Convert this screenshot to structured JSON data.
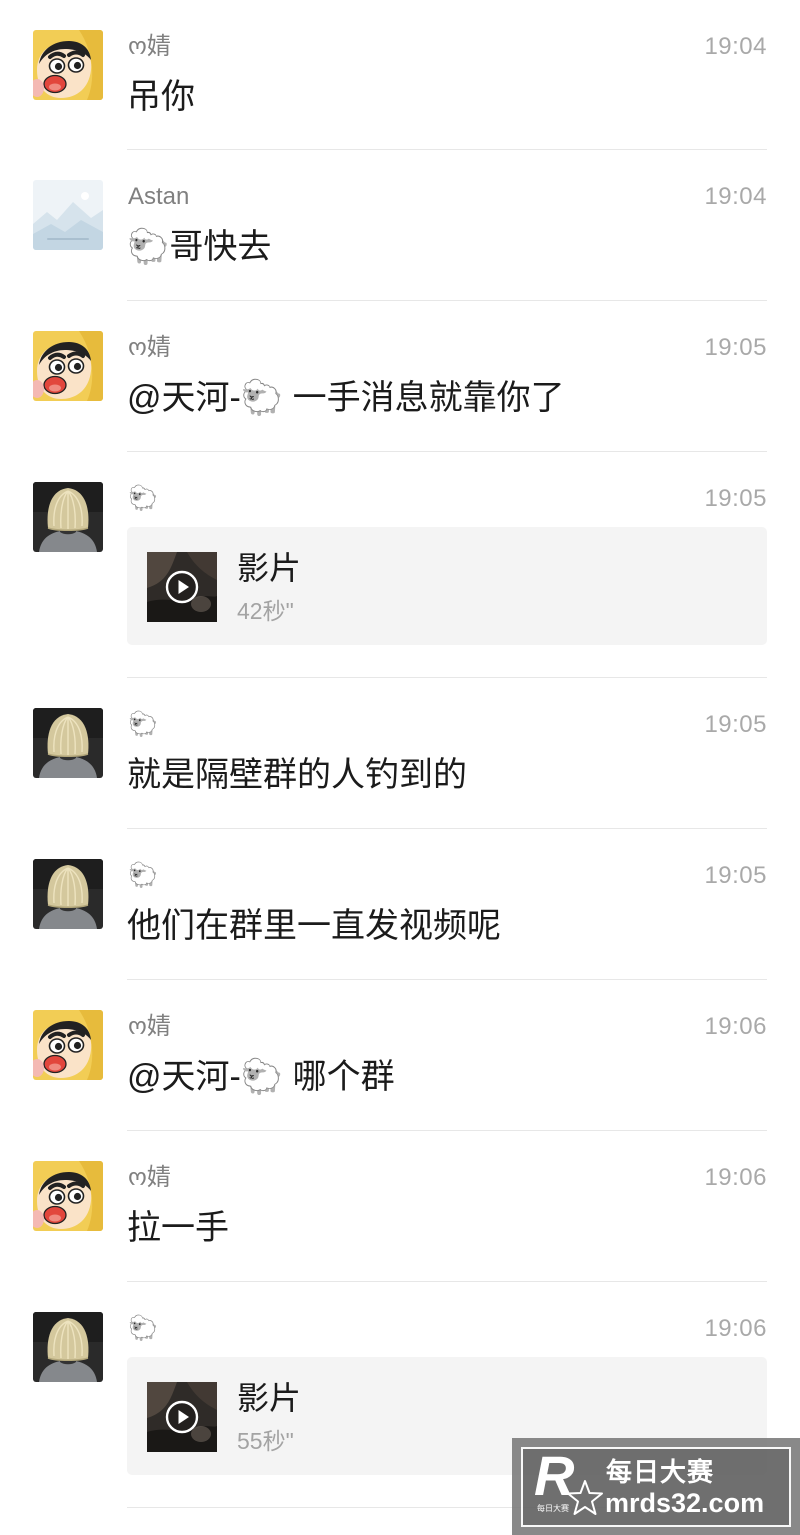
{
  "messages": [
    {
      "sender": "ო婧",
      "avatar": "shinchan-avatar",
      "time": "19:04",
      "text": "吊你"
    },
    {
      "sender": "Astan",
      "avatar": "landscape-avatar",
      "time": "19:04",
      "text": "🐑哥快去"
    },
    {
      "sender": "ო婧",
      "avatar": "shinchan-avatar",
      "time": "19:05",
      "text": "@天河-🐑 一手消息就靠你了"
    },
    {
      "sender": "🐑",
      "avatar": "blonde-hair-avatar",
      "time": "19:05",
      "video": {
        "title": "影片",
        "duration": "42秒\"",
        "thumbnail": "video-thumbnail"
      }
    },
    {
      "sender": "🐑",
      "avatar": "blonde-hair-avatar",
      "time": "19:05",
      "text": "就是隔壁群的人钓到的"
    },
    {
      "sender": "🐑",
      "avatar": "blonde-hair-avatar",
      "time": "19:05",
      "text": "他们在群里一直发视频呢"
    },
    {
      "sender": "ო婧",
      "avatar": "shinchan-avatar",
      "time": "19:06",
      "text": "@天河-🐑 哪个群"
    },
    {
      "sender": "ო婧",
      "avatar": "shinchan-avatar",
      "time": "19:06",
      "text": "拉一手"
    },
    {
      "sender": "🐑",
      "avatar": "blonde-hair-avatar",
      "time": "19:06",
      "video": {
        "title": "影片",
        "duration": "55秒\"",
        "thumbnail": "video-thumbnail"
      }
    }
  ],
  "watermark": {
    "logo_letter": "R",
    "logo_caption": "每日大赛",
    "title": "每日大赛",
    "site": "mrds32.com"
  },
  "colors": {
    "page_background": "#ffffff",
    "message_text": "#1b1b1b",
    "sender_name": "#808080",
    "timestamp": "#a9a9a9",
    "secondary_text": "#a3a3a3",
    "separator": "#e7e7e7",
    "card_background": "#f4f4f4"
  }
}
